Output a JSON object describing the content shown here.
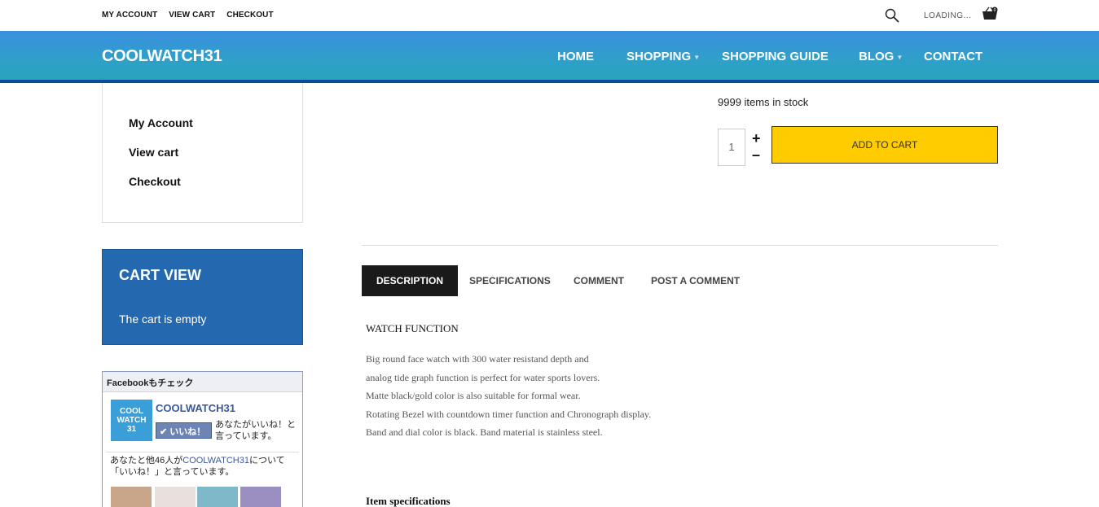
{
  "topbar": {
    "links": [
      "MY ACCOUNT",
      "VIEW CART",
      "CHECKOUT"
    ],
    "loading": "LOADING..."
  },
  "nav": {
    "logo": "COOLWATCH31",
    "items": [
      {
        "label": "HOME",
        "has_caret": false
      },
      {
        "label": "SHOPPING",
        "has_caret": true
      },
      {
        "label": "SHOPPING GUIDE",
        "has_caret": false
      },
      {
        "label": "BLOG",
        "has_caret": true
      },
      {
        "label": "CONTACT",
        "has_caret": false
      }
    ]
  },
  "sidebar": {
    "account_links": [
      "My Account",
      "View cart",
      "Checkout"
    ],
    "cart_title": "CART VIEW",
    "cart_status": "The cart is empty"
  },
  "facebook": {
    "header": "Facebookもチェック",
    "logo_lines": [
      "COOL",
      "WATCH",
      "31"
    ],
    "page_name": "COOLWATCH31",
    "like_button": "✔ いいね！",
    "like_text": "あなたがいいね！と言っています。",
    "count_prefix": "あなたと他46人が",
    "count_link": "COOLWATCH31",
    "count_suffix": "について「いいね！」と言っています。"
  },
  "product": {
    "stock": "9999 items in stock",
    "quantity": "1",
    "add_to_cart": "ADD TO CART"
  },
  "tabs": [
    "DESCRIPTION",
    "SPECIFICATIONS",
    "COMMENT",
    "POST A COMMENT"
  ],
  "description": {
    "title": "WATCH FUNCTION",
    "lines": [
      "Big round face watch with 300 water resistand depth and",
      "analog tide graph function is perfect for water sports lovers.",
      "Matte black/gold color is also suitable for formal wear.",
      "Rotating Bezel with countdown timer function and Chronograph display.",
      "Band and dial color is black. Band material is stainless steel."
    ],
    "spec_title": "Item specifications"
  },
  "colors": {
    "nav_top": "#3a8fe0",
    "nav_bottom": "#2aa3bd",
    "nav_border": "#0c4d9a",
    "cart_view_bg": "#2468b0",
    "add_to_cart_bg": "#ffcc00",
    "active_tab_bg": "#1a1a1a"
  }
}
